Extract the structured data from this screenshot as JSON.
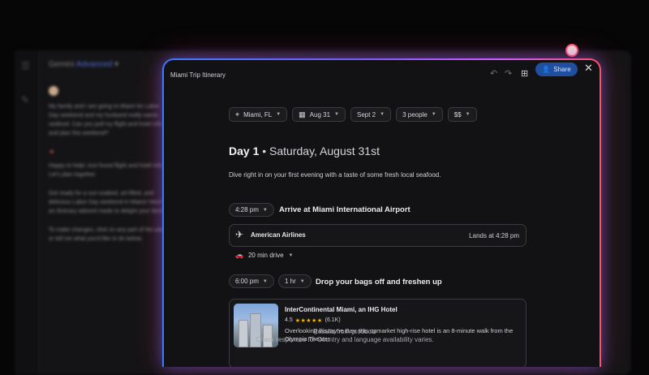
{
  "background_app": {
    "title": "Gemini",
    "title_accent": "Advanced",
    "messages": [
      "My family and I are going to Miami for Labor Day weekend and my husband really wants seafood. Can you pull my flight and hotel info and plan this weekend?",
      "Happy to help! Just found flight and hotel info. Let's plan together.",
      "Get ready for a sun-soaked, art-filled, and delicious Labor Day weekend in Miami! Here's an itinerary tailored made to delight your family.",
      "To make changes, click on any part of the plan or tell me what you'd like to do below."
    ]
  },
  "window": {
    "title": "Miami Trip Itinerary",
    "share_label": "Share",
    "close_icon": "close-icon"
  },
  "filters": {
    "location": "Miami, FL",
    "start_date": "Aug 31",
    "end_date": "Sept 2",
    "people": "3 people",
    "price": "$$"
  },
  "day": {
    "label": "Day 1",
    "separator": "•",
    "date": "Saturday, August 31st",
    "description": "Dive right in on your first evening with a taste of some fresh local seafood."
  },
  "events": [
    {
      "time": "4:28 pm",
      "title": "Arrive at Miami International Airport",
      "airline": "American Airlines",
      "lands": "Lands at 4:28 pm"
    },
    {
      "drive": "20 min drive"
    },
    {
      "time": "6:00 pm",
      "duration": "1 hr",
      "title": "Drop your bags off and freshen up",
      "hotel_name": "InterContinental Miami, an IHG Hotel",
      "rating": "4.5",
      "stars": "★★★★★",
      "reviews": "(6.1K)",
      "description": "Overlooking Biscayne Bay, this upmarket high-rise hotel is an 8-minute walk from the Olympia Theater."
    }
  ],
  "footer": {
    "line1": "Results from products",
    "line2": "Check responses for",
    "line3": "Country and language availability varies."
  }
}
